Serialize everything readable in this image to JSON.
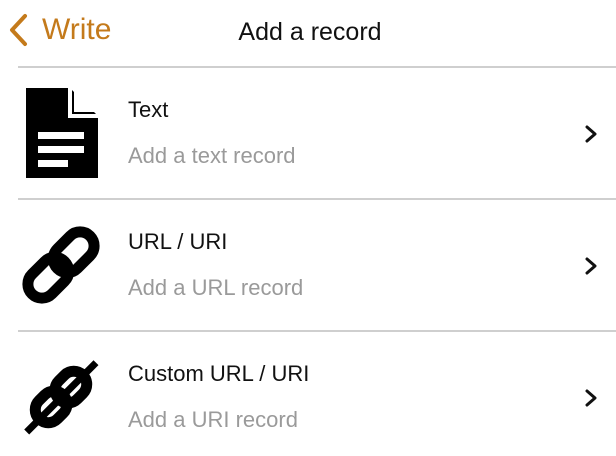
{
  "nav": {
    "back_label": "Write",
    "title": "Add a record",
    "back_icon": "chevron-left-icon",
    "accent_color": "#c47a1b"
  },
  "records": [
    {
      "title": "Text",
      "subtitle": "Add a text record",
      "icon": "document-icon"
    },
    {
      "title": "URL / URI",
      "subtitle": "Add a URL record",
      "icon": "link-icon"
    },
    {
      "title": "Custom URL / URI",
      "subtitle": "Add a URI record",
      "icon": "custom-link-icon"
    }
  ],
  "row_chevron_icon": "chevron-right-icon",
  "colors": {
    "title_text": "#111111",
    "subtitle_text": "#9a9a9a",
    "divider": "#cfcfcf"
  }
}
